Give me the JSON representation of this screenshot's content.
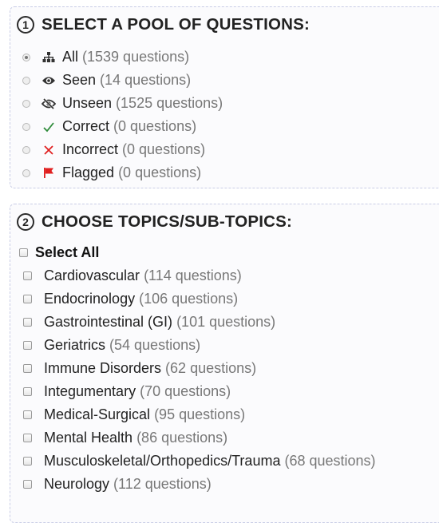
{
  "pool": {
    "step": "1",
    "title": "SELECT A POOL OF QUESTIONS:",
    "options": [
      {
        "label": "All",
        "count": "(1539 questions)",
        "icon": "sitemap-icon",
        "selected": true
      },
      {
        "label": "Seen",
        "count": "(14 questions)",
        "icon": "eye-icon",
        "selected": false
      },
      {
        "label": "Unseen",
        "count": "(1525 questions)",
        "icon": "eye-slash-icon",
        "selected": false
      },
      {
        "label": "Correct",
        "count": "(0 questions)",
        "icon": "check-icon",
        "selected": false
      },
      {
        "label": "Incorrect",
        "count": "(0 questions)",
        "icon": "x-icon",
        "selected": false
      },
      {
        "label": "Flagged",
        "count": "(0 questions)",
        "icon": "flag-icon",
        "selected": false
      }
    ]
  },
  "topics": {
    "step": "2",
    "title": "CHOOSE TOPICS/SUB-TOPICS:",
    "select_all": "Select All",
    "items": [
      {
        "label": "Cardiovascular",
        "count": "(114 questions)"
      },
      {
        "label": "Endocrinology",
        "count": "(106 questions)"
      },
      {
        "label": "Gastrointestinal (GI)",
        "count": "(101 questions)"
      },
      {
        "label": "Geriatrics",
        "count": "(54 questions)"
      },
      {
        "label": "Immune Disorders",
        "count": "(62 questions)"
      },
      {
        "label": "Integumentary",
        "count": "(70 questions)"
      },
      {
        "label": "Medical-Surgical",
        "count": "(95 questions)"
      },
      {
        "label": "Mental Health",
        "count": "(86 questions)"
      },
      {
        "label": "Musculoskeletal/Orthopedics/Trauma",
        "count": "(68 questions)"
      },
      {
        "label": "Neurology",
        "count": "(112 questions)"
      }
    ]
  },
  "colors": {
    "check": "#2e8b3a",
    "incorrect": "#e02020",
    "flag": "#e02020",
    "icon": "#333333"
  }
}
